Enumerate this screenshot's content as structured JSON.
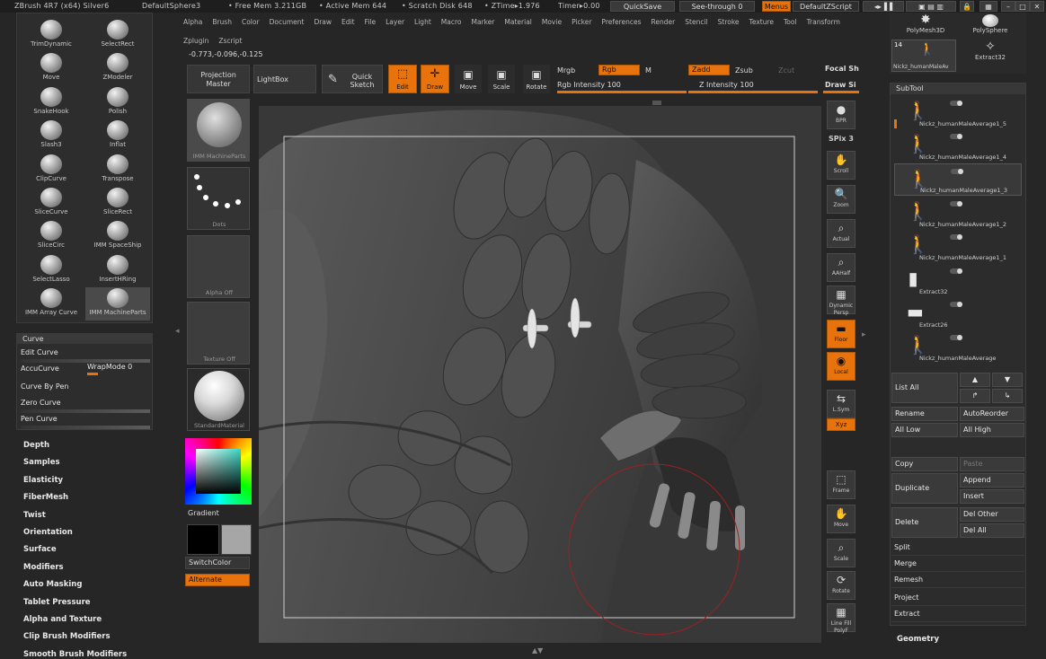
{
  "title": {
    "app": "ZBrush 4R7 (x64) Silver6",
    "document": "DefaultSphere3",
    "free_mem": "• Free Mem 3.211GB",
    "active_mem": "• Active Mem 644",
    "scratch": "• Scratch Disk 648",
    "ztime": "• ZTime▸1.976",
    "timer": "Timer▸0.00",
    "quicksave": "QuickSave",
    "seethrough": "See-through  0",
    "menus": "Menus",
    "zscript": "DefaultZScript"
  },
  "menu": [
    "Alpha",
    "Brush",
    "Color",
    "Document",
    "Draw",
    "Edit",
    "File",
    "Layer",
    "Light",
    "Macro",
    "Marker",
    "Material",
    "Movie",
    "Picker",
    "Preferences",
    "Render",
    "Stencil",
    "Stroke",
    "Texture",
    "Tool",
    "Transform"
  ],
  "menu2": [
    "Zplugin",
    "Zscript"
  ],
  "coords": "-0.773,-0.096,-0.125",
  "shelf": {
    "projection_master": "Projection Master",
    "lightbox": "LightBox",
    "quick_sketch": "Quick Sketch",
    "edit": "Edit",
    "draw": "Draw",
    "move": "Move",
    "scale": "Scale",
    "rotate": "Rotate",
    "mrgb": "Mrgb",
    "rgb": "Rgb",
    "m": "M",
    "zadd": "Zadd",
    "zsub": "Zsub",
    "zcut": "Zcut",
    "rgb_intensity": "Rgb Intensity 100",
    "z_intensity": "Z Intensity 100",
    "rgb_intensity_fraction": 1.0,
    "z_intensity_fraction": 1.0,
    "focal_shift": "Focal Sh",
    "draw_size": "Draw Si"
  },
  "brushes": [
    {
      "label": "TrimDynamic"
    },
    {
      "label": "SelectRect"
    },
    {
      "label": "Move"
    },
    {
      "label": "ZModeler"
    },
    {
      "label": "SnakeHook"
    },
    {
      "label": "Polish"
    },
    {
      "label": "Slash3"
    },
    {
      "label": "Inflat"
    },
    {
      "label": "ClipCurve"
    },
    {
      "label": "Transpose"
    },
    {
      "label": "SliceCurve"
    },
    {
      "label": "SliceRect"
    },
    {
      "label": "SliceCirc"
    },
    {
      "label": "IMM SpaceShip"
    },
    {
      "label": "SelectLasso"
    },
    {
      "label": "InsertHRing"
    },
    {
      "label": "IMM Array Curve"
    },
    {
      "label": "IMM MachineParts"
    }
  ],
  "curve": {
    "header": "Curve",
    "edit_curve": "Edit Curve",
    "accucurve": "AccuCurve",
    "wrapmode": "WrapMode 0",
    "curve_by_pen": "Curve By Pen",
    "zero_curve": "Zero Curve",
    "pen_curve": "Pen Curve"
  },
  "subpalettes": [
    "Depth",
    "Samples",
    "Elasticity",
    "FiberMesh",
    "Twist",
    "Orientation",
    "Surface",
    "Modifiers",
    "Auto Masking",
    "Tablet Pressure",
    "Alpha and Texture",
    "Clip Brush Modifiers",
    "Smooth Brush Modifiers"
  ],
  "tray": {
    "brush_caption": "IMM MachineParts",
    "stroke_caption": "Dots",
    "alpha_caption": "Alpha Off",
    "texture_caption": "Texture Off",
    "material_caption": "StandardMaterial",
    "gradient": "Gradient",
    "switchcolor": "SwitchColor",
    "alternate": "Alternate",
    "main_color": "#000000",
    "secondary_color": "#a6a6a6"
  },
  "right_toolbar": [
    {
      "label": "BPR",
      "icon": "●"
    },
    {
      "label": "SPix 3",
      "icon": ""
    },
    {
      "label": "Scroll",
      "icon": "✋"
    },
    {
      "label": "Zoom",
      "icon": "🔍"
    },
    {
      "label": "Actual",
      "icon": "⌕"
    },
    {
      "label": "AAHalf",
      "icon": "⌕"
    },
    {
      "label": "Dynamic Persp",
      "icon": "▦"
    },
    {
      "label": "Floor",
      "icon": "▬"
    },
    {
      "label": "Local",
      "icon": "◉"
    },
    {
      "label": "L.Sym",
      "icon": "⇆"
    },
    {
      "label": "Xyz",
      "icon": "⟳"
    },
    {
      "label": "Frame",
      "icon": "⬚"
    },
    {
      "label": "Move",
      "icon": "✋"
    },
    {
      "label": "Scale",
      "icon": "⌕"
    },
    {
      "label": "Rotate",
      "icon": "⟳"
    },
    {
      "label": "Line Fill PolyF",
      "icon": "▦"
    }
  ],
  "tool_thumbs": {
    "polymesh": "PolyMesh3D",
    "polysphere": "PolySphere",
    "count": "14",
    "nickz": "Nickz_humanMaleAv",
    "extract32": "Extract32"
  },
  "subtool": {
    "header": "SubTool",
    "items": [
      {
        "name": "Nickz_humanMaleAverage1_5",
        "icon": "🚶"
      },
      {
        "name": "Nickz_humanMaleAverage1_4",
        "icon": "🚶"
      },
      {
        "name": "Nickz_humanMaleAverage1_3",
        "icon": "🚶"
      },
      {
        "name": "Nickz_humanMaleAverage1_2",
        "icon": "🚶"
      },
      {
        "name": "Nickz_humanMaleAverage1_1",
        "icon": "🚶"
      },
      {
        "name": "Extract32",
        "icon": "▮"
      },
      {
        "name": "Extract26",
        "icon": "▬"
      },
      {
        "name": "Nickz_humanMaleAverage",
        "icon": "🚶"
      }
    ],
    "list_all": "List All",
    "rename": "Rename",
    "autoreorder": "AutoReorder",
    "all_low": "All Low",
    "all_high": "All High",
    "copy": "Copy",
    "paste": "Paste",
    "duplicate": "Duplicate",
    "append": "Append",
    "insert": "Insert",
    "delete": "Delete",
    "del_other": "Del Other",
    "del_all": "Del All",
    "split": "Split",
    "merge": "Merge",
    "remesh": "Remesh",
    "project": "Project",
    "extract": "Extract",
    "geometry": "Geometry"
  }
}
